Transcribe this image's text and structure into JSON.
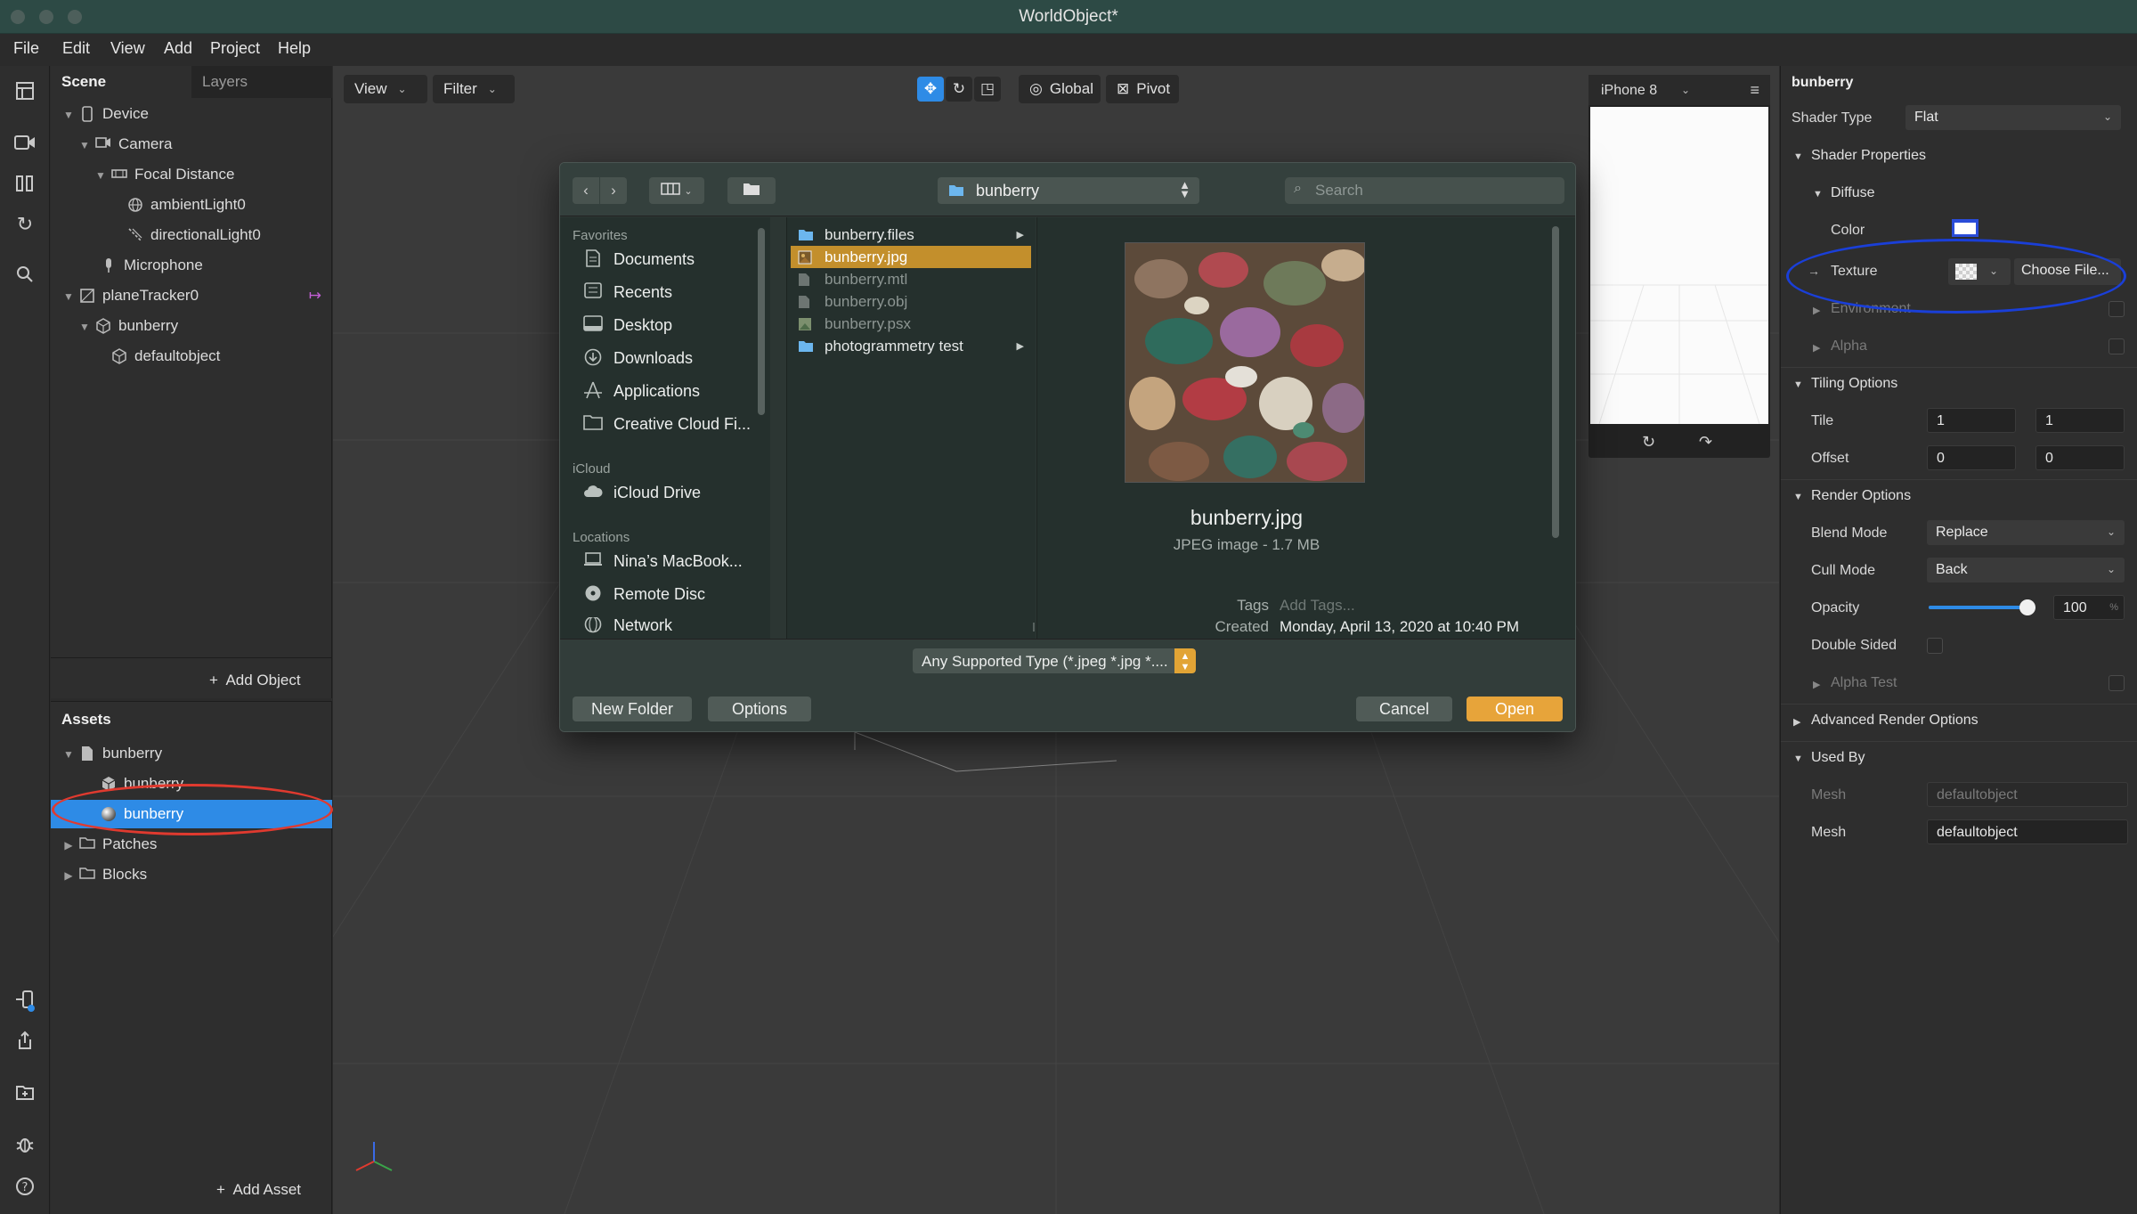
{
  "window": {
    "title": "WorldObject*"
  },
  "menu": [
    "File",
    "Edit",
    "View",
    "Add",
    "Project",
    "Help"
  ],
  "scene_panel": {
    "tabs": [
      "Scene",
      "Layers"
    ],
    "tree": [
      {
        "label": "Device",
        "icon": "phone-icon"
      },
      {
        "label": "Camera",
        "icon": "camera-icon"
      },
      {
        "label": "Focal Distance",
        "icon": "focal-distance-icon"
      },
      {
        "label": "ambientLight0",
        "icon": "globe-icon"
      },
      {
        "label": "directionalLight0",
        "icon": "light-icon"
      },
      {
        "label": "Microphone",
        "icon": "microphone-icon"
      },
      {
        "label": "planeTracker0",
        "icon": "plane-tracker-icon"
      },
      {
        "label": "bunberry",
        "icon": "cube-icon"
      },
      {
        "label": "defaultobject",
        "icon": "mesh-icon"
      }
    ],
    "add_object": "Add Object"
  },
  "assets_panel": {
    "title": "Assets",
    "items": [
      {
        "label": "bunberry",
        "icon": "file-icon"
      },
      {
        "label": "bunberry",
        "icon": "cube-icon"
      },
      {
        "label": "bunberry",
        "icon": "material-sphere-icon",
        "selected": true
      },
      {
        "label": "Patches",
        "icon": "folder-icon"
      },
      {
        "label": "Blocks",
        "icon": "folder-icon"
      }
    ],
    "add_asset": "Add Asset"
  },
  "viewport": {
    "view_button": "View",
    "filter_button": "Filter",
    "global_button": "Global",
    "pivot_button": "Pivot",
    "device_preview": "iPhone 8"
  },
  "inspector": {
    "object_name": "bunberry",
    "shader_type_label": "Shader Type",
    "shader_type_value": "Flat",
    "shader_properties": "Shader Properties",
    "diffuse": "Diffuse",
    "color_label": "Color",
    "texture_label": "Texture",
    "choose_file": "Choose File...",
    "environment": "Environment",
    "alpha": "Alpha",
    "tiling_options": "Tiling Options",
    "tile_label": "Tile",
    "tile_values": [
      "1",
      "1"
    ],
    "offset_label": "Offset",
    "offset_values": [
      "0",
      "0"
    ],
    "render_options": "Render Options",
    "blend_mode_label": "Blend Mode",
    "blend_mode_value": "Replace",
    "cull_mode_label": "Cull Mode",
    "cull_mode_value": "Back",
    "opacity_label": "Opacity",
    "opacity_value": "100",
    "opacity_fraction": 1.0,
    "opacity_unit": "%",
    "double_sided_label": "Double Sided",
    "alpha_test": "Alpha Test",
    "advanced_render_options": "Advanced Render Options",
    "used_by": "Used By",
    "mesh_label": "Mesh",
    "used_by_rows": [
      {
        "label": "Mesh",
        "value": "defaultobject",
        "dim": true
      },
      {
        "label": "Mesh",
        "value": "defaultobject",
        "dim": false
      }
    ]
  },
  "dialog": {
    "location": "bunberry",
    "search_placeholder": "Search",
    "sidebar": {
      "favorites_header": "Favorites",
      "favorites": [
        {
          "label": "Documents",
          "icon": "documents-icon"
        },
        {
          "label": "Recents",
          "icon": "recents-icon"
        },
        {
          "label": "Desktop",
          "icon": "desktop-icon"
        },
        {
          "label": "Downloads",
          "icon": "downloads-icon"
        },
        {
          "label": "Applications",
          "icon": "applications-icon"
        },
        {
          "label": "Creative Cloud Fi...",
          "icon": "folder-icon"
        }
      ],
      "icloud_header": "iCloud",
      "icloud": [
        {
          "label": "iCloud Drive",
          "icon": "cloud-icon"
        }
      ],
      "locations_header": "Locations",
      "locations": [
        {
          "label": "Nina’s MacBook...",
          "icon": "laptop-icon"
        },
        {
          "label": "Remote Disc",
          "icon": "disc-icon"
        },
        {
          "label": "Network",
          "icon": "network-icon"
        }
      ]
    },
    "files": [
      {
        "name": "bunberry.files",
        "type": "folder",
        "dim": false,
        "selected": false
      },
      {
        "name": "bunberry.jpg",
        "type": "image",
        "dim": false,
        "selected": true
      },
      {
        "name": "bunberry.mtl",
        "type": "doc",
        "dim": true,
        "selected": false
      },
      {
        "name": "bunberry.obj",
        "type": "doc",
        "dim": true,
        "selected": false
      },
      {
        "name": "bunberry.psx",
        "type": "image",
        "dim": true,
        "selected": false
      },
      {
        "name": "photogrammetry test",
        "type": "folder",
        "dim": false,
        "selected": false
      }
    ],
    "preview": {
      "name": "bunberry.jpg",
      "kind": "JPEG image - 1.7 MB",
      "tags_label": "Tags",
      "tags_placeholder": "Add Tags...",
      "created_label": "Created",
      "created_value": "Monday, April 13, 2020 at 10:40 PM"
    },
    "file_type": "Any Supported Type (*.jpeg *.jpg *....",
    "new_folder": "New Folder",
    "options": "Options",
    "cancel": "Cancel",
    "open": "Open"
  },
  "colors": {
    "accent_blue": "#2e8be6",
    "open_button": "#e7a43a",
    "selected_file": "#c38f2c",
    "annotation_red": "#e03a2f",
    "annotation_blue": "#1a3fd8"
  }
}
